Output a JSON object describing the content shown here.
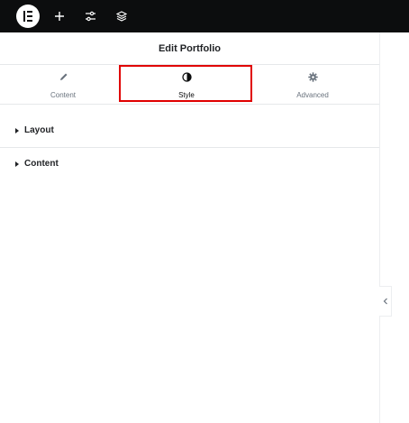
{
  "topbar": {
    "logo_icon": "elementor-logo-icon",
    "icons": [
      "plus-icon",
      "settings-sliders-icon",
      "layers-icon"
    ]
  },
  "panel": {
    "title": "Edit Portfolio",
    "tabs": [
      {
        "label": "Content",
        "icon": "pencil-icon"
      },
      {
        "label": "Style",
        "icon": "half-circle-icon",
        "active": true
      },
      {
        "label": "Advanced",
        "icon": "gear-icon"
      }
    ],
    "sections": [
      {
        "label": "Layout"
      },
      {
        "label": "Content"
      }
    ]
  },
  "colors": {
    "topbar_bg": "#0c0d0e",
    "highlight": "#e00000",
    "text": "#1f2124",
    "muted": "#69727d"
  }
}
